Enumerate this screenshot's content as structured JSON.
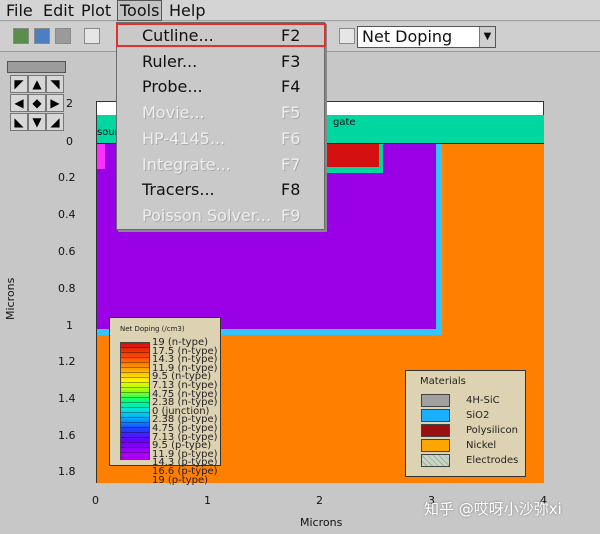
{
  "menu": {
    "items": [
      {
        "label": "File"
      },
      {
        "label": "Edit"
      },
      {
        "label": "Plot"
      },
      {
        "label": "Tools"
      },
      {
        "label": "Help"
      }
    ]
  },
  "toolbar": {
    "doping_select": {
      "value": "Net Doping"
    }
  },
  "tools_menu": {
    "items": [
      {
        "label": "Cutline...",
        "shortcut": "F2",
        "enabled": true
      },
      {
        "label": "Ruler...",
        "shortcut": "F3",
        "enabled": true
      },
      {
        "label": "Probe...",
        "shortcut": "F4",
        "enabled": true
      },
      {
        "label": "Movie...",
        "shortcut": "F5",
        "enabled": false
      },
      {
        "label": "HP-4145...",
        "shortcut": "F6",
        "enabled": false
      },
      {
        "label": "Integrate...",
        "shortcut": "F7",
        "enabled": false
      },
      {
        "label": "Tracers...",
        "shortcut": "F8",
        "enabled": true
      },
      {
        "label": "Poisson Solver...",
        "shortcut": "F9",
        "enabled": false
      }
    ],
    "highlight_color": "#e0312d"
  },
  "plot": {
    "y_ticks": [
      "2",
      "0",
      "0.2",
      "0.4",
      "0.6",
      "0.8",
      "1",
      "1.2",
      "1.4",
      "1.6",
      "1.8"
    ],
    "x_ticks": [
      "0",
      "1",
      "2",
      "3",
      "4"
    ],
    "y_title": "Microns",
    "x_title": "Microns",
    "source_label": "sour",
    "gate_label": "gate",
    "colors": {
      "orange": "#ff7f00",
      "purple": "#9a00e6",
      "teal": "#00d6a0",
      "red": "#d41010",
      "blue": "#1c9cff"
    }
  },
  "doping_legend": {
    "title": "Net Doping (/cm3)",
    "labels": [
      "19 (n-type)",
      "17.5 (n-type)",
      "14.3 (n-type)",
      "11.9 (n-type)",
      "9.5 (n-type)",
      "7.13 (n-type)",
      "4.75 (n-type)",
      "2.38 (n-type)",
      "0 (junction)",
      "2.38 (p-type)",
      "4.75 (p-type)",
      "7.13 (p-type)",
      "9.5 (p-type)",
      "11.9 (p-type)",
      "14.3 (p-type)",
      "16.6 (p-type)",
      "19 (p-type)"
    ]
  },
  "materials_legend": {
    "title": "Materials",
    "items": [
      {
        "label": "4H-SiC",
        "color": "#a0a0a0"
      },
      {
        "label": "SiO2",
        "color": "#1ab0ff"
      },
      {
        "label": "Polysilicon",
        "color": "#9a1010"
      },
      {
        "label": "Nickel",
        "color": "#ffa500"
      },
      {
        "label": "Electrodes",
        "color": "#c8d6c8"
      }
    ]
  },
  "watermark": "知乎 @哎呀小沙弥xi"
}
